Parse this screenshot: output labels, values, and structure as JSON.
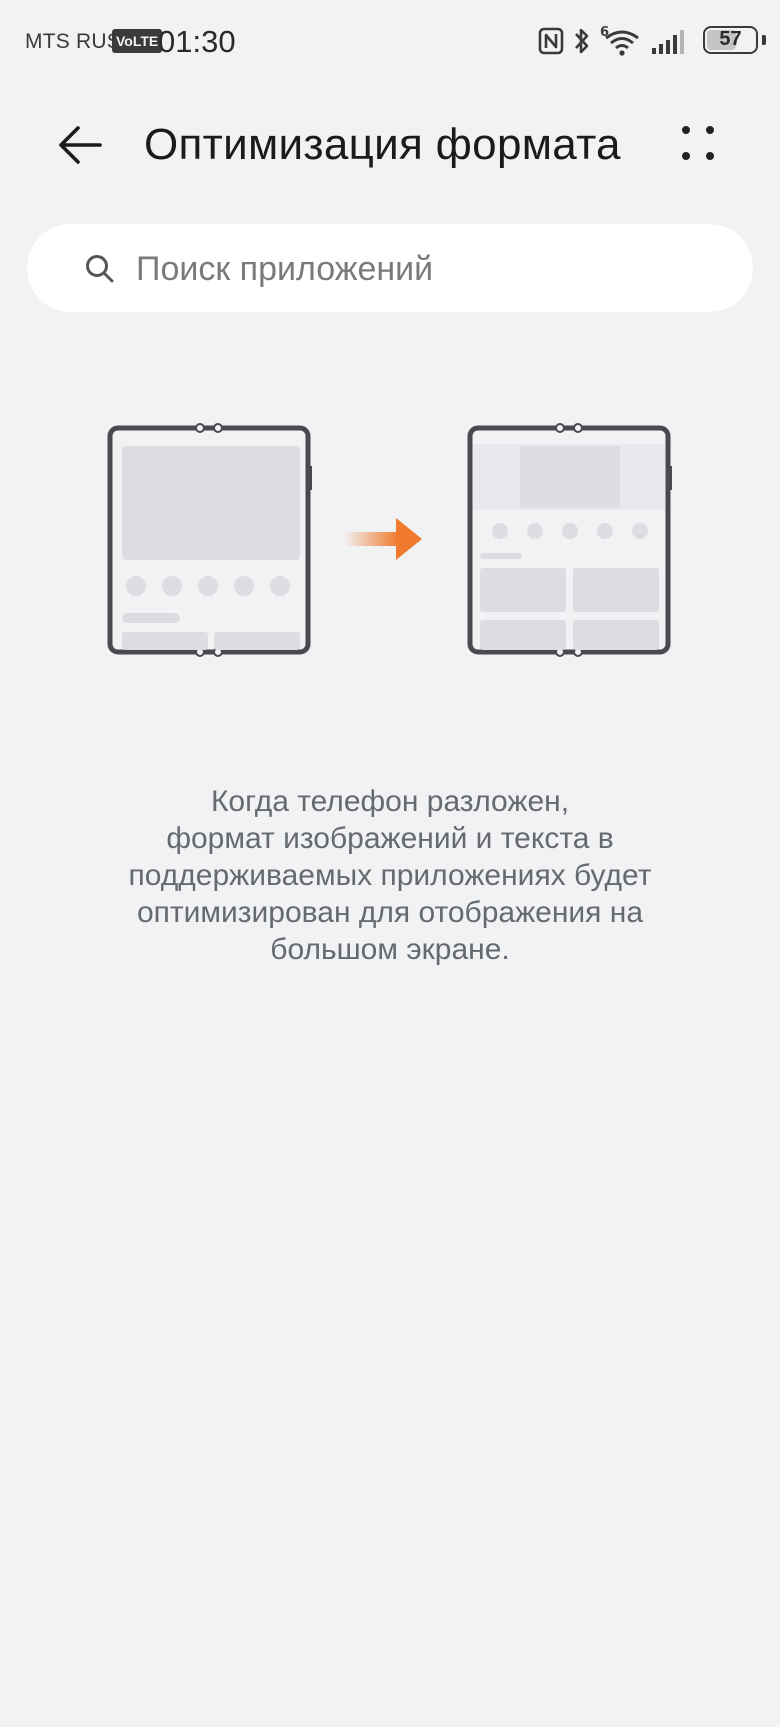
{
  "status_bar": {
    "carrier": "MTS RUS",
    "volte": "VoLTE",
    "time": "01:30",
    "battery_percent": "57",
    "icons": [
      "nfc-icon",
      "bluetooth-icon",
      "wifi-6-icon",
      "signal-icon",
      "battery-icon"
    ],
    "wifi_label": "6"
  },
  "header": {
    "title": "Оптимизация формата",
    "back_icon": "arrow-left-icon",
    "more_icon": "more-dots-icon"
  },
  "search": {
    "placeholder": "Поиск приложений",
    "value": ""
  },
  "description": {
    "lines": [
      "Когда телефон разложен,",
      "формат изображений и текста в",
      "поддерживаемых приложениях будет",
      "оптимизирован для отображения на",
      "большом экране."
    ]
  },
  "colors": {
    "background": "#f1f2f4",
    "accent_arrow": "#f07b2e",
    "device_frame": "#4a4a4e",
    "placeholder_block": "#dcdde0"
  }
}
